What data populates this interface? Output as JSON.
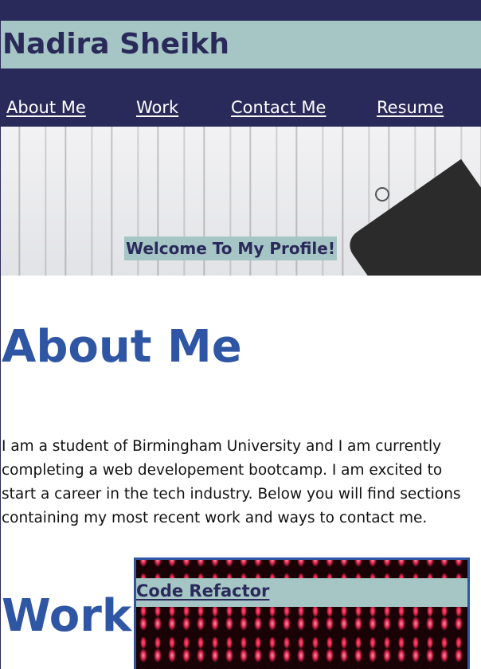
{
  "header": {
    "name": "Nadira Sheikh",
    "nav": [
      {
        "label": "About Me"
      },
      {
        "label": "Work"
      },
      {
        "label": "Contact Me"
      },
      {
        "label": "Resume"
      }
    ]
  },
  "hero": {
    "welcome": "Welcome To My Profile!"
  },
  "about": {
    "title": "About Me",
    "text": "I am a student of Birmingham University and I am currently completing a web developement bootcamp. I am excited to start a career in the tech industry. Below you will find sections containing my most recent work and ways to contact me."
  },
  "work": {
    "title": "Work",
    "projects": [
      {
        "label": "Code Refactor"
      }
    ]
  },
  "colors": {
    "header_bg": "#2a2a5a",
    "accent_bar": "#a6c6c6",
    "heading": "#2f56a4"
  }
}
